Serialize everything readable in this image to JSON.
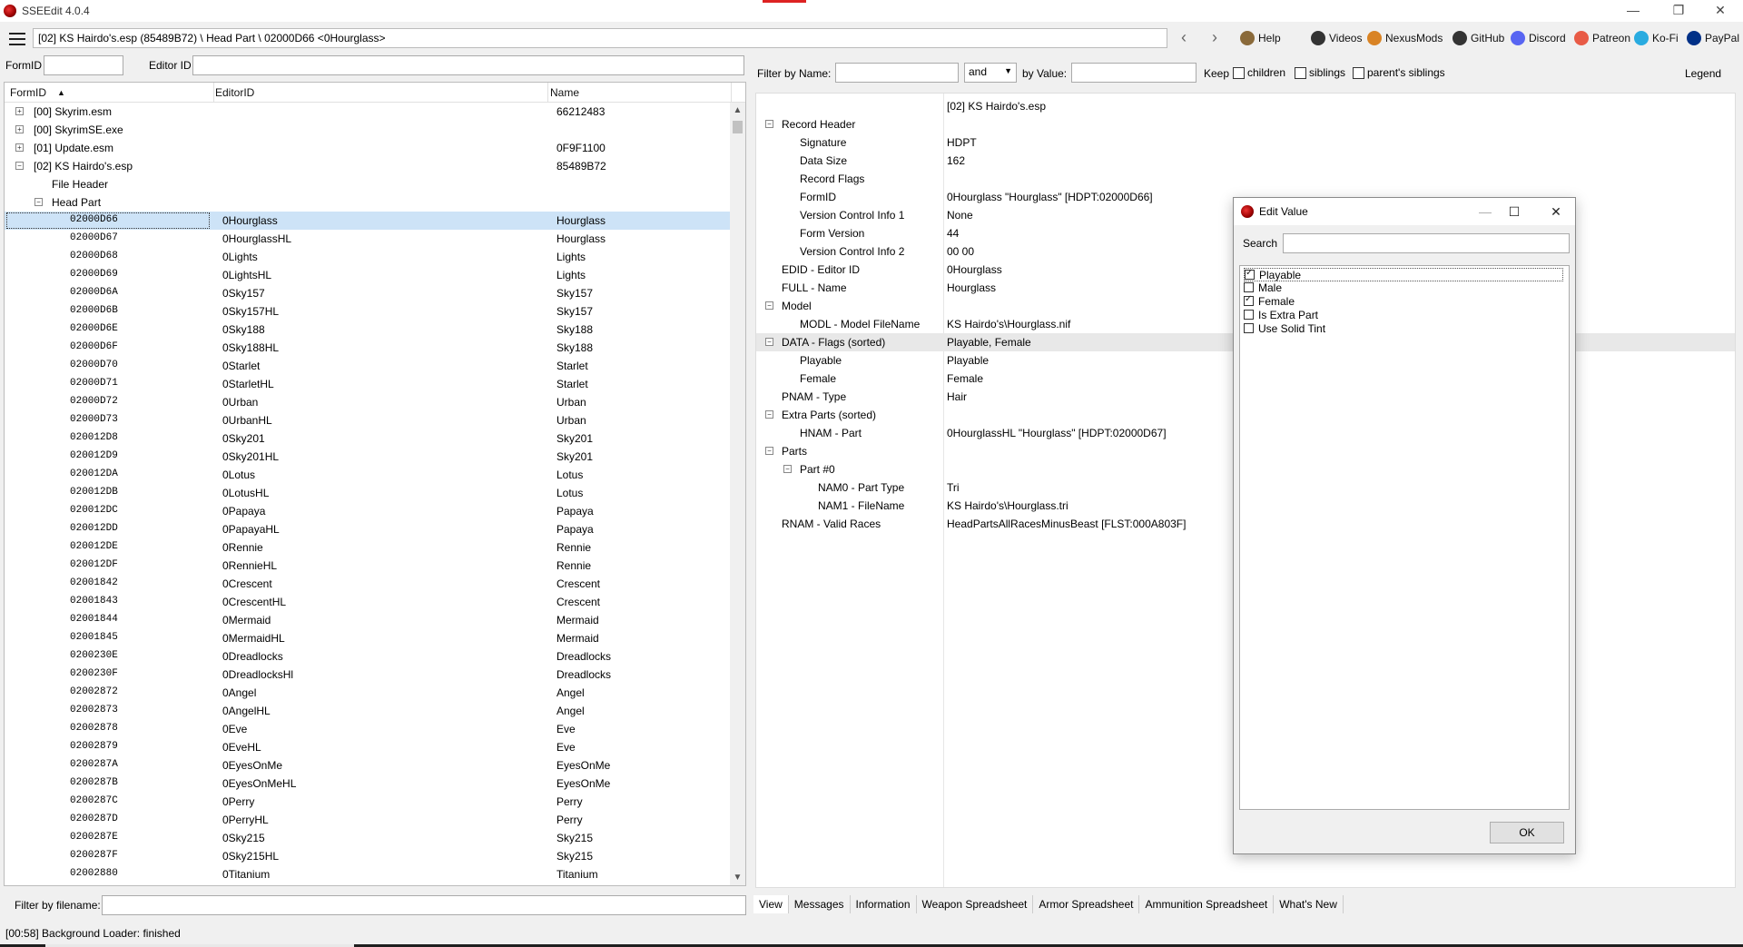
{
  "window": {
    "title": "SSEEdit 4.0.4",
    "minimize": "—",
    "restore": "❐",
    "close": "✕"
  },
  "toolbar": {
    "path": "[02] KS Hairdo's.esp (85489B72) \\ Head Part \\ 02000D66 <0Hourglass>",
    "back": "‹",
    "forward": "›",
    "links": [
      {
        "label": "Help",
        "icon": "book-icon",
        "color": "#8a6a3a"
      },
      {
        "label": "Videos",
        "icon": "video-icon",
        "color": "#333333"
      },
      {
        "label": "NexusMods",
        "icon": "nexus-icon",
        "color": "#d98324"
      },
      {
        "label": "GitHub",
        "icon": "github-icon",
        "color": "#333333"
      },
      {
        "label": "Discord",
        "icon": "discord-icon",
        "color": "#5865f2"
      },
      {
        "label": "Patreon",
        "icon": "patreon-icon",
        "color": "#e85b46"
      },
      {
        "label": "Ko-Fi",
        "icon": "kofi-icon",
        "color": "#29abe0"
      },
      {
        "label": "PayPal",
        "icon": "paypal-icon",
        "color": "#003087"
      }
    ]
  },
  "left": {
    "formid_label": "FormID",
    "editorid_label": "Editor ID",
    "columns": {
      "formid": "FormID",
      "editorid": "EditorID",
      "name": "Name"
    },
    "tree": [
      {
        "formid": "[00] Skyrim.esm",
        "editorid": "",
        "name": "66212483",
        "kind": "plugin"
      },
      {
        "formid": "[00] SkyrimSE.exe",
        "editorid": "",
        "name": "",
        "kind": "plugin"
      },
      {
        "formid": "[01] Update.esm",
        "editorid": "",
        "name": "0F9F1100",
        "kind": "plugin"
      },
      {
        "formid": "[02] KS Hairdo's.esp",
        "editorid": "",
        "name": "85489B72",
        "kind": "plugin-open"
      },
      {
        "formid": "File Header",
        "editorid": "",
        "name": "",
        "kind": "child"
      },
      {
        "formid": "Head Part",
        "editorid": "",
        "name": "",
        "kind": "group-open"
      },
      {
        "formid": "02000D66",
        "editorid": "0Hourglass",
        "name": "Hourglass",
        "kind": "record",
        "selected": true
      },
      {
        "formid": "02000D67",
        "editorid": "0HourglassHL",
        "name": "Hourglass",
        "kind": "record"
      },
      {
        "formid": "02000D68",
        "editorid": "0Lights",
        "name": "Lights",
        "kind": "record"
      },
      {
        "formid": "02000D69",
        "editorid": "0LightsHL",
        "name": "Lights",
        "kind": "record"
      },
      {
        "formid": "02000D6A",
        "editorid": "0Sky157",
        "name": "Sky157",
        "kind": "record"
      },
      {
        "formid": "02000D6B",
        "editorid": "0Sky157HL",
        "name": "Sky157",
        "kind": "record"
      },
      {
        "formid": "02000D6E",
        "editorid": "0Sky188",
        "name": "Sky188",
        "kind": "record"
      },
      {
        "formid": "02000D6F",
        "editorid": "0Sky188HL",
        "name": "Sky188",
        "kind": "record"
      },
      {
        "formid": "02000D70",
        "editorid": "0Starlet",
        "name": "Starlet",
        "kind": "record"
      },
      {
        "formid": "02000D71",
        "editorid": "0StarletHL",
        "name": "Starlet",
        "kind": "record"
      },
      {
        "formid": "02000D72",
        "editorid": "0Urban",
        "name": "Urban",
        "kind": "record"
      },
      {
        "formid": "02000D73",
        "editorid": "0UrbanHL",
        "name": "Urban",
        "kind": "record"
      },
      {
        "formid": "020012D8",
        "editorid": "0Sky201",
        "name": "Sky201",
        "kind": "record"
      },
      {
        "formid": "020012D9",
        "editorid": "0Sky201HL",
        "name": "Sky201",
        "kind": "record"
      },
      {
        "formid": "020012DA",
        "editorid": "0Lotus",
        "name": "Lotus",
        "kind": "record"
      },
      {
        "formid": "020012DB",
        "editorid": "0LotusHL",
        "name": "Lotus",
        "kind": "record"
      },
      {
        "formid": "020012DC",
        "editorid": "0Papaya",
        "name": "Papaya",
        "kind": "record"
      },
      {
        "formid": "020012DD",
        "editorid": "0PapayaHL",
        "name": "Papaya",
        "kind": "record"
      },
      {
        "formid": "020012DE",
        "editorid": "0Rennie",
        "name": "Rennie",
        "kind": "record"
      },
      {
        "formid": "020012DF",
        "editorid": "0RennieHL",
        "name": "Rennie",
        "kind": "record"
      },
      {
        "formid": "02001842",
        "editorid": "0Crescent",
        "name": "Crescent",
        "kind": "record"
      },
      {
        "formid": "02001843",
        "editorid": "0CrescentHL",
        "name": "Crescent",
        "kind": "record"
      },
      {
        "formid": "02001844",
        "editorid": "0Mermaid",
        "name": "Mermaid",
        "kind": "record"
      },
      {
        "formid": "02001845",
        "editorid": "0MermaidHL",
        "name": "Mermaid",
        "kind": "record"
      },
      {
        "formid": "0200230E",
        "editorid": "0Dreadlocks",
        "name": "Dreadlocks",
        "kind": "record"
      },
      {
        "formid": "0200230F",
        "editorid": "0DreadlocksHl",
        "name": "Dreadlocks",
        "kind": "record"
      },
      {
        "formid": "02002872",
        "editorid": "0Angel",
        "name": "Angel",
        "kind": "record"
      },
      {
        "formid": "02002873",
        "editorid": "0AngelHL",
        "name": "Angel",
        "kind": "record"
      },
      {
        "formid": "02002878",
        "editorid": "0Eve",
        "name": "Eve",
        "kind": "record"
      },
      {
        "formid": "02002879",
        "editorid": "0EveHL",
        "name": "Eve",
        "kind": "record"
      },
      {
        "formid": "0200287A",
        "editorid": "0EyesOnMe",
        "name": "EyesOnMe",
        "kind": "record"
      },
      {
        "formid": "0200287B",
        "editorid": "0EyesOnMeHL",
        "name": "EyesOnMe",
        "kind": "record"
      },
      {
        "formid": "0200287C",
        "editorid": "0Perry",
        "name": "Perry",
        "kind": "record"
      },
      {
        "formid": "0200287D",
        "editorid": "0PerryHL",
        "name": "Perry",
        "kind": "record"
      },
      {
        "formid": "0200287E",
        "editorid": "0Sky215",
        "name": "Sky215",
        "kind": "record"
      },
      {
        "formid": "0200287F",
        "editorid": "0Sky215HL",
        "name": "Sky215",
        "kind": "record"
      },
      {
        "formid": "02002880",
        "editorid": "0Titanium",
        "name": "Titanium",
        "kind": "record"
      }
    ],
    "filename_filter_label": "Filter by filename:"
  },
  "right": {
    "filter_name_label": "Filter by Name:",
    "and_option": "and",
    "by_value_label": "by Value:",
    "keep_label": "Keep",
    "children_label": "children",
    "siblings_label": "siblings",
    "parents_siblings_label": "parent's siblings",
    "legend_label": "Legend",
    "file_header_value": "[02] KS Hairdo's.esp",
    "rows": [
      {
        "key": "Record Header",
        "value": "",
        "level": 0,
        "toggle": "−"
      },
      {
        "key": "Signature",
        "value": "HDPT",
        "level": 1
      },
      {
        "key": "Data Size",
        "value": "162",
        "level": 1
      },
      {
        "key": "Record Flags",
        "value": "",
        "level": 1
      },
      {
        "key": "FormID",
        "value": "0Hourglass \"Hourglass\" [HDPT:02000D66]",
        "level": 1
      },
      {
        "key": "Version Control Info 1",
        "value": "None",
        "level": 1
      },
      {
        "key": "Form Version",
        "value": "44",
        "level": 1
      },
      {
        "key": "Version Control Info 2",
        "value": "00 00",
        "level": 1
      },
      {
        "key": "EDID - Editor ID",
        "value": "0Hourglass",
        "level": 0
      },
      {
        "key": "FULL - Name",
        "value": "Hourglass",
        "level": 0
      },
      {
        "key": "Model",
        "value": "",
        "level": 0,
        "toggle": "−"
      },
      {
        "key": "MODL - Model FileName",
        "value": "KS Hairdo's\\Hourglass.nif",
        "level": 1
      },
      {
        "key": "DATA - Flags (sorted)",
        "value": "Playable, Female",
        "level": 0,
        "toggle": "−",
        "highlight": true
      },
      {
        "key": "Playable",
        "value": "Playable",
        "level": 1
      },
      {
        "key": "Female",
        "value": "Female",
        "level": 1
      },
      {
        "key": "PNAM - Type",
        "value": "Hair",
        "level": 0
      },
      {
        "key": "Extra Parts (sorted)",
        "value": "",
        "level": 0,
        "toggle": "−"
      },
      {
        "key": "HNAM - Part",
        "value": "0HourglassHL \"Hourglass\" [HDPT:02000D67]",
        "level": 1
      },
      {
        "key": "Parts",
        "value": "",
        "level": 0,
        "toggle": "−"
      },
      {
        "key": "Part #0",
        "value": "",
        "level": 1,
        "toggle": "−"
      },
      {
        "key": "NAM0 - Part Type",
        "value": "Tri",
        "level": 2
      },
      {
        "key": "NAM1 - FileName",
        "value": "KS Hairdo's\\Hourglass.tri",
        "level": 2
      },
      {
        "key": "RNAM - Valid Races",
        "value": "HeadPartsAllRacesMinusBeast [FLST:000A803F]",
        "level": 0
      }
    ],
    "tabs": [
      "View",
      "Messages",
      "Information",
      "Weapon Spreadsheet",
      "Armor Spreadsheet",
      "Ammunition Spreadsheet",
      "What's New"
    ]
  },
  "dialog": {
    "title": "Edit Value",
    "search_label": "Search",
    "options": [
      {
        "label": "Playable",
        "checked": true
      },
      {
        "label": "Male",
        "checked": false
      },
      {
        "label": "Female",
        "checked": true
      },
      {
        "label": "Is Extra Part",
        "checked": false
      },
      {
        "label": "Use Solid Tint",
        "checked": false
      }
    ],
    "ok_label": "OK",
    "minimize": "—",
    "maximize": "☐",
    "close": "✕"
  },
  "status": {
    "text": "[00:58] Background Loader: finished"
  },
  "colors": {
    "selection": "#cde3f7",
    "highlight_row": "#e8e8e8",
    "accent_red": "#d22222"
  }
}
